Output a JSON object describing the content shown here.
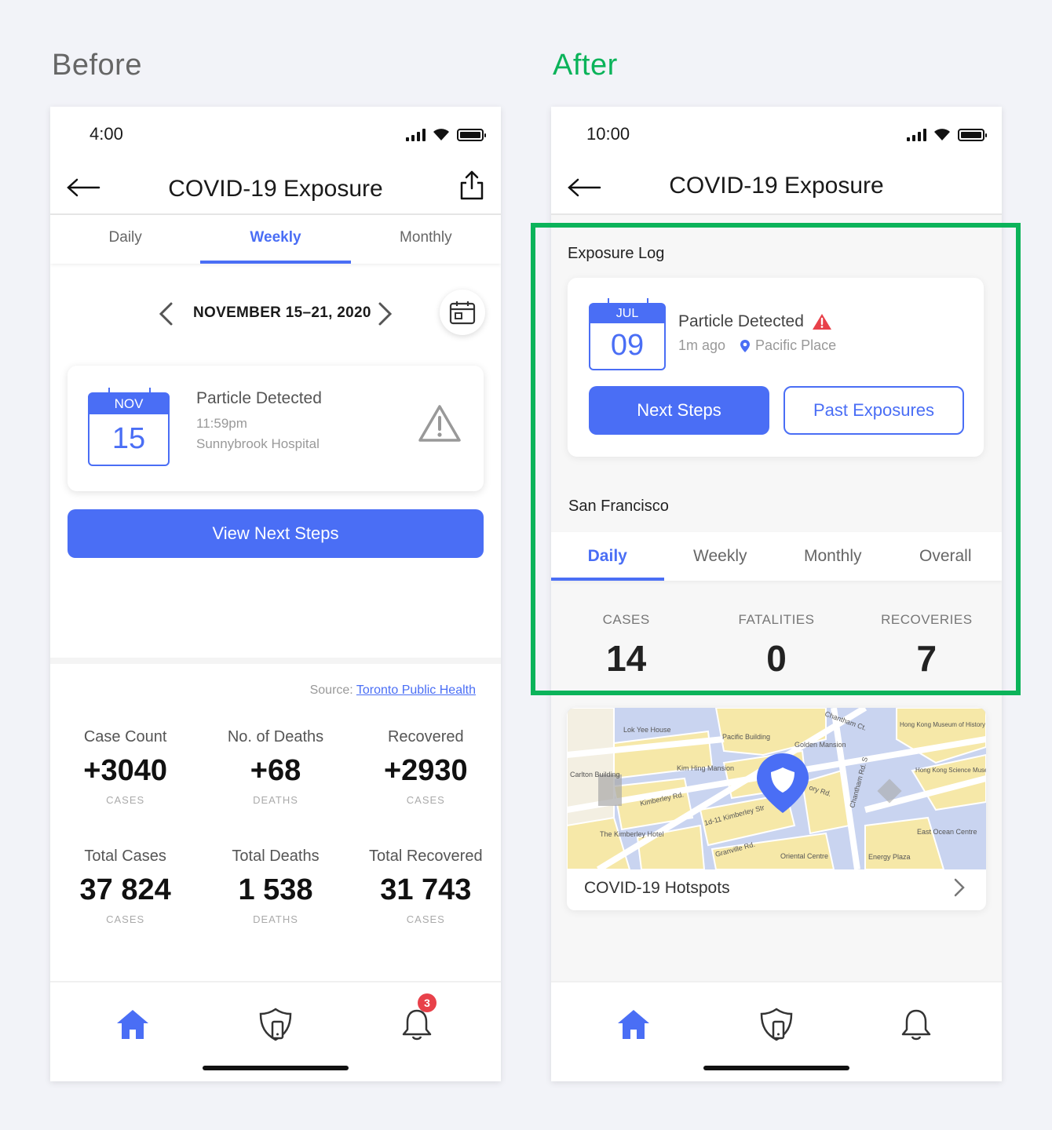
{
  "headings": {
    "before": "Before",
    "after": "After"
  },
  "colors": {
    "accent": "#4a6ef5",
    "highlight": "#0bb35a",
    "badge": "#e8414a",
    "warning": "#e8414a"
  },
  "before": {
    "status_time": "4:00",
    "nav_title": "COVID-19 Exposure",
    "tabs": [
      {
        "label": "Daily"
      },
      {
        "label": "Weekly",
        "active": true
      },
      {
        "label": "Monthly"
      }
    ],
    "date_range": "NOVEMBER 15–21, 2020",
    "exposure": {
      "month": "NOV",
      "day": "15",
      "title": "Particle Detected",
      "time": "11:59pm",
      "place": "Sunnybrook Hospital"
    },
    "next_button": "View Next Steps",
    "source_prefix": "Source:",
    "source_link": "Toronto Public Health",
    "stats_row1": [
      {
        "label": "Case Count",
        "value": "+3040",
        "unit": "CASES"
      },
      {
        "label": "No. of Deaths",
        "value": "+68",
        "unit": "DEATHS"
      },
      {
        "label": "Recovered",
        "value": "+2930",
        "unit": "CASES"
      }
    ],
    "stats_row2": [
      {
        "label": "Total Cases",
        "value": "37 824",
        "unit": "CASES"
      },
      {
        "label": "Total Deaths",
        "value": "1 538",
        "unit": "DEATHS"
      },
      {
        "label": "Total Recovered",
        "value": "31 743",
        "unit": "CASES"
      }
    ],
    "notification_count": "3",
    "bottom_icons": [
      "home-icon",
      "shield-phone-icon",
      "bell-icon"
    ]
  },
  "after": {
    "status_time": "10:00",
    "nav_title": "COVID-19 Exposure",
    "log_label": "Exposure Log",
    "exposure": {
      "month": "JUL",
      "day": "09",
      "title": "Particle Detected",
      "ago": "1m ago",
      "place": "Pacific Place"
    },
    "next_button": "Next Steps",
    "past_button": "Past Exposures",
    "city_label": "San Francisco",
    "tabs": [
      {
        "label": "Daily",
        "active": true
      },
      {
        "label": "Weekly"
      },
      {
        "label": "Monthly"
      },
      {
        "label": "Overall"
      }
    ],
    "stats": [
      {
        "label": "CASES",
        "value": "14"
      },
      {
        "label": "FATALITIES",
        "value": "0"
      },
      {
        "label": "RECOVERIES",
        "value": "7"
      }
    ],
    "map_labels": {
      "lok_yee": "Lok Yee House",
      "pacific_building": "Pacific Building",
      "chantham_ct": "Chantham Ct.",
      "hk_history": "Hong Kong Museum of History",
      "golden_mansion": "Golden Mansion",
      "carlton": "Carlton Building",
      "kim_hing": "Kim Hing Mansion",
      "chantham_rd": "Chantham Rd. S",
      "hk_science": "Hong Kong Science Museum",
      "kimberley_rd": "Kimberley Rd.",
      "kimberley_str": "1d-11 Kimberley Str",
      "kimberley_hotel": "The Kimberley Hotel",
      "granville": "Granville Rd.",
      "oriental": "Oriental Centre",
      "energy_plaza": "Energy Plaza",
      "east_ocean": "East Ocean Centre",
      "mory_rd": "ory Rd."
    },
    "map_title": "COVID-19 Hotspots",
    "bottom_icons": [
      "home-icon",
      "shield-phone-icon",
      "bell-icon"
    ]
  }
}
